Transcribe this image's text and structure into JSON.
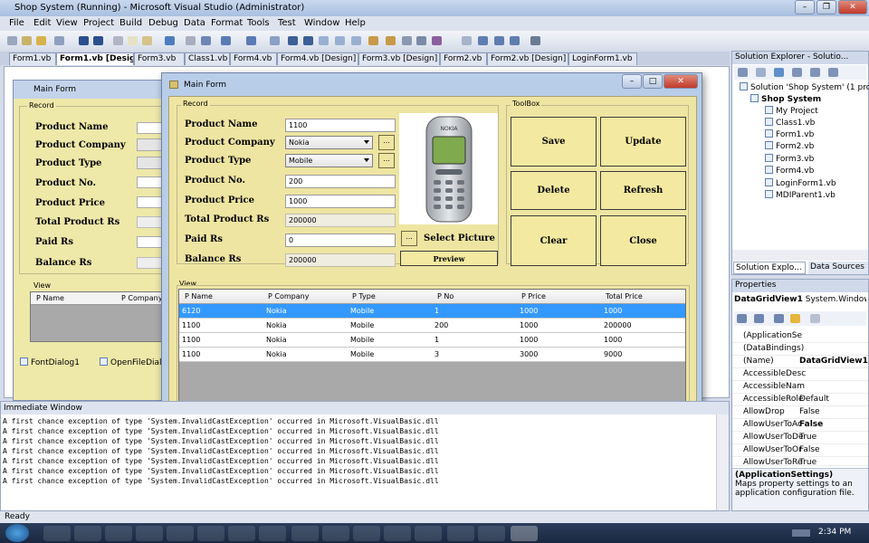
{
  "window": {
    "title": "Shop System (Running) - Microsoft Visual Studio (Administrator)"
  },
  "menu": [
    "File",
    "Edit",
    "View",
    "Project",
    "Build",
    "Debug",
    "Data",
    "Format",
    "Tools",
    "Test",
    "Window",
    "Help"
  ],
  "tabs": [
    "Form1.vb",
    "Form1.vb [Design]",
    "Form3.vb",
    "Class1.vb",
    "Form4.vb",
    "Form4.vb [Design]",
    "Form3.vb [Design]",
    "Form2.vb",
    "Form2.vb [Design]",
    "LoginForm1.vb"
  ],
  "designer": {
    "form_title": "Main Form",
    "record_label": "Record",
    "labels": [
      "Product Name",
      "Product Company",
      "Product Type",
      "Product No.",
      "Product Price",
      "Total Product Rs",
      "Paid Rs",
      "Balance Rs"
    ],
    "view_label": "View",
    "col1": "P Name",
    "col2": "P Company",
    "tray": [
      "FontDialog1",
      "OpenFileDialo"
    ]
  },
  "form": {
    "title": "Main Form",
    "record_label": "Record",
    "toolbox_label": "ToolBox",
    "view_label": "View",
    "fields": [
      {
        "label": "Product Name",
        "value": "1100"
      },
      {
        "label": "Product Company",
        "value": "Nokia"
      },
      {
        "label": "Product Type",
        "value": "Mobile"
      },
      {
        "label": "Product No.",
        "value": "200"
      },
      {
        "label": "Product Price",
        "value": "1000"
      },
      {
        "label": "Total Product Rs",
        "value": "200000"
      },
      {
        "label": "Paid Rs",
        "value": "0"
      },
      {
        "label": "Balance Rs",
        "value": "200000"
      }
    ],
    "dots_label": "...",
    "select_picture": "Select Picture",
    "preview": "Preview",
    "phone_brand": "NOKIA",
    "buttons": {
      "save": "Save",
      "update": "Update",
      "delete": "Delete",
      "refresh": "Refresh",
      "clear": "Clear",
      "close": "Close"
    },
    "grid": {
      "columns": [
        "P Name",
        "P Company",
        "P Type",
        "P No",
        "P Price",
        "Total Price"
      ],
      "rows": [
        [
          "6120",
          "Nokia",
          "Mobile",
          "1",
          "1000",
          "1000"
        ],
        [
          "1100",
          "Nokia",
          "Mobile",
          "200",
          "1000",
          "200000"
        ],
        [
          "1100",
          "Nokia",
          "Mobile",
          "1",
          "1000",
          "1000"
        ],
        [
          "1100",
          "Nokia",
          "Mobile",
          "3",
          "3000",
          "9000"
        ]
      ]
    }
  },
  "immediate": {
    "title": "Immediate Window",
    "lines": [
      "A first chance exception of type 'System.InvalidCastException' occurred in Microsoft.VisualBasic.dll",
      "A first chance exception of type 'System.InvalidCastException' occurred in Microsoft.VisualBasic.dll",
      "A first chance exception of type 'System.InvalidCastException' occurred in Microsoft.VisualBasic.dll",
      "A first chance exception of type 'System.InvalidCastException' occurred in Microsoft.VisualBasic.dll",
      "A first chance exception of type 'System.InvalidCastException' occurred in Microsoft.VisualBasic.dll",
      "A first chance exception of type 'System.InvalidCastException' occurred in Microsoft.VisualBasic.dll",
      "A first chance exception of type 'System.InvalidCastException' occurred in Microsoft.VisualBasic.dll"
    ]
  },
  "status": "Ready",
  "solution": {
    "title": "Solution Explorer - Solutio...",
    "items": [
      "Solution 'Shop System' (1 project)",
      "Shop System",
      "My Project",
      "Class1.vb",
      "Form1.vb",
      "Form2.vb",
      "Form3.vb",
      "Form4.vb",
      "LoginForm1.vb",
      "MDIParent1.vb"
    ],
    "tab1": "Solution Explo...",
    "tab2": "Data Sources"
  },
  "properties": {
    "title": "Properties",
    "object": "DataGridView1",
    "object_type": "System.Windows.",
    "rows": [
      [
        "(ApplicationSe",
        ""
      ],
      [
        "(DataBindings)",
        ""
      ],
      [
        "(Name)",
        "DataGridView1"
      ],
      [
        "AccessibleDesc",
        ""
      ],
      [
        "AccessibleNam",
        ""
      ],
      [
        "AccessibleRole",
        "Default"
      ],
      [
        "AllowDrop",
        "False"
      ],
      [
        "AllowUserToAc",
        "False"
      ],
      [
        "AllowUserToDe",
        "True"
      ],
      [
        "AllowUserToOr",
        "False"
      ],
      [
        "AllowUserToRe",
        "True"
      ]
    ],
    "desc_title": "(ApplicationSettings)",
    "desc": "Maps property settings to an application configuration file."
  },
  "taskbar": {
    "time": "2:34 PM"
  },
  "colors": {
    "form_bg": "#efe5a2",
    "selection": "#3399ff"
  }
}
